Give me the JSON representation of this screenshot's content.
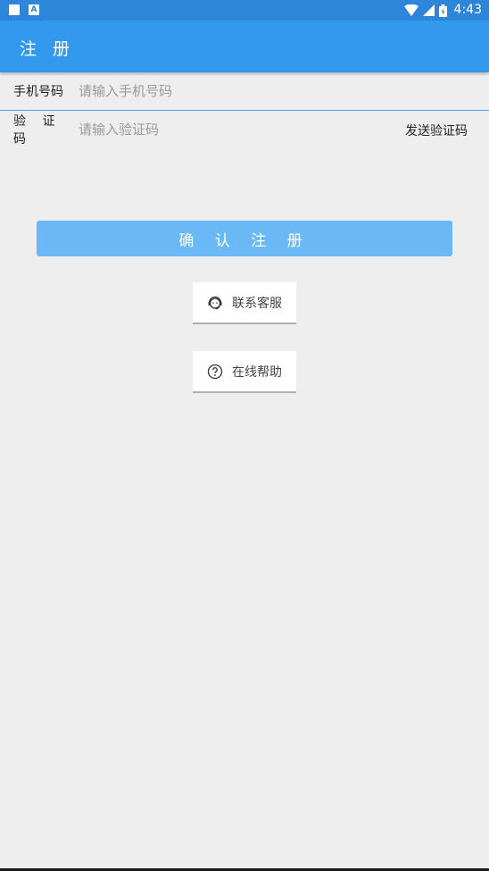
{
  "status_bar": {
    "notification_icons": [
      "square-icon",
      "a-icon"
    ],
    "a_icon_letter": "A",
    "time": "4:43",
    "system_icons": [
      "wifi-icon",
      "signal-icon",
      "battery-icon"
    ]
  },
  "app_bar": {
    "title": "注 册",
    "background": "#3399ee"
  },
  "form": {
    "phone": {
      "label": "手机号码",
      "placeholder": "请输入手机号码",
      "value": ""
    },
    "code": {
      "label": "验 证 码",
      "placeholder": "请输入验证码",
      "value": "",
      "send_label": "发送验证码"
    }
  },
  "confirm_button": {
    "label": "确 认 注 册",
    "color": "#6ab8f6"
  },
  "support": {
    "contact_label": "联系客服",
    "contact_icon": "headset-icon",
    "help_label": "在线帮助",
    "help_icon": "question-circle-icon"
  }
}
